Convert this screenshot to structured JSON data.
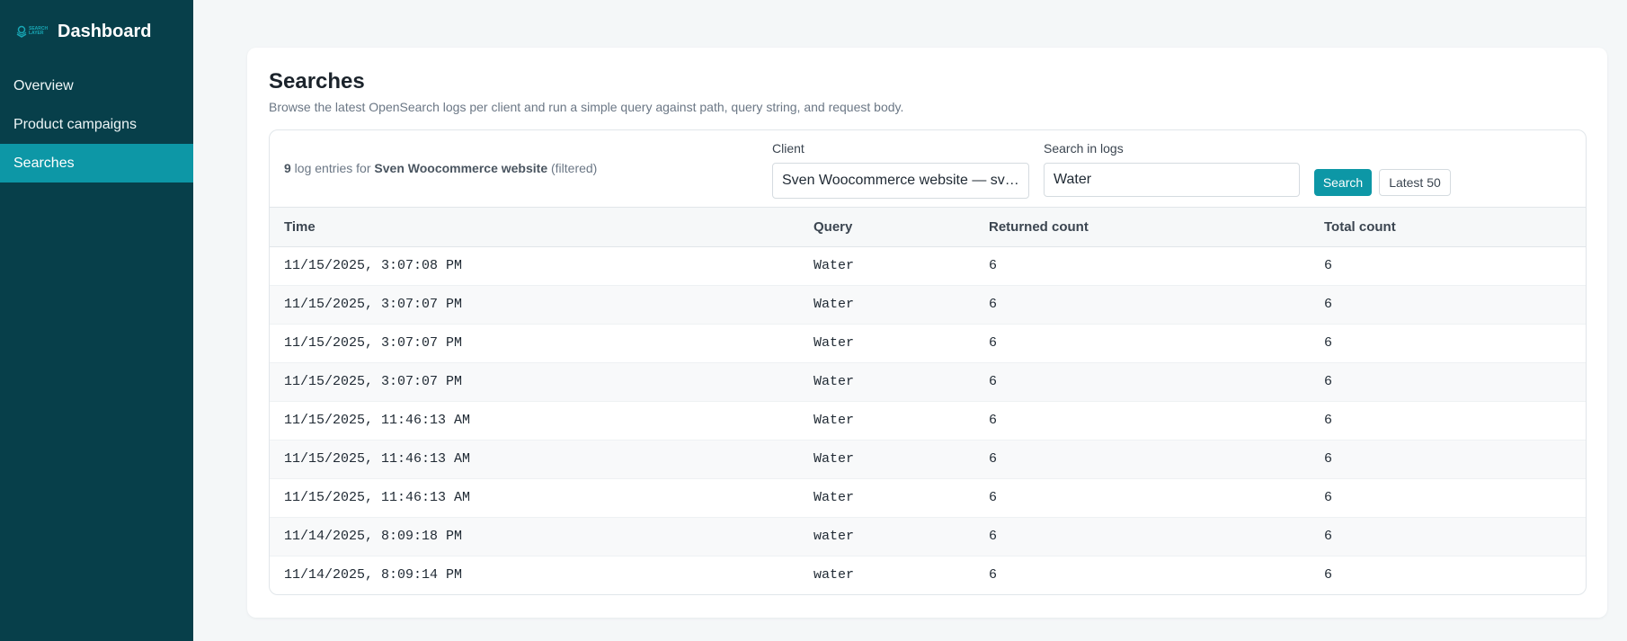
{
  "brand": {
    "logo_text_line1": "SEARCH",
    "logo_text_line2": "LAYER",
    "title": "Dashboard"
  },
  "nav": {
    "items": [
      {
        "label": "Overview",
        "active": false
      },
      {
        "label": "Product campaigns",
        "active": false
      },
      {
        "label": "Searches",
        "active": true
      }
    ]
  },
  "page": {
    "title": "Searches",
    "subtitle": "Browse the latest OpenSearch logs per client and run a simple query against path, query string, and request body."
  },
  "summary": {
    "count": "9",
    "middle": " log entries for ",
    "client": "Sven Woocommerce website",
    "suffix": " (filtered)"
  },
  "filters": {
    "client_label": "Client",
    "client_value": "Sven Woocommerce website — sv…",
    "search_label": "Search in logs",
    "search_value": "Water",
    "search_button": "Search",
    "latest_button": "Latest 50"
  },
  "table": {
    "headers": [
      "Time",
      "Query",
      "Returned count",
      "Total count"
    ],
    "rows": [
      [
        "11/15/2025, 3:07:08 PM",
        "Water",
        "6",
        "6"
      ],
      [
        "11/15/2025, 3:07:07 PM",
        "Water",
        "6",
        "6"
      ],
      [
        "11/15/2025, 3:07:07 PM",
        "Water",
        "6",
        "6"
      ],
      [
        "11/15/2025, 3:07:07 PM",
        "Water",
        "6",
        "6"
      ],
      [
        "11/15/2025, 11:46:13 AM",
        "Water",
        "6",
        "6"
      ],
      [
        "11/15/2025, 11:46:13 AM",
        "Water",
        "6",
        "6"
      ],
      [
        "11/15/2025, 11:46:13 AM",
        "Water",
        "6",
        "6"
      ],
      [
        "11/14/2025, 8:09:18 PM",
        "water",
        "6",
        "6"
      ],
      [
        "11/14/2025, 8:09:14 PM",
        "water",
        "6",
        "6"
      ]
    ]
  },
  "colors": {
    "sidebar_bg": "#073f4a",
    "accent": "#0d97a6",
    "page_bg": "#f4f7f8"
  }
}
